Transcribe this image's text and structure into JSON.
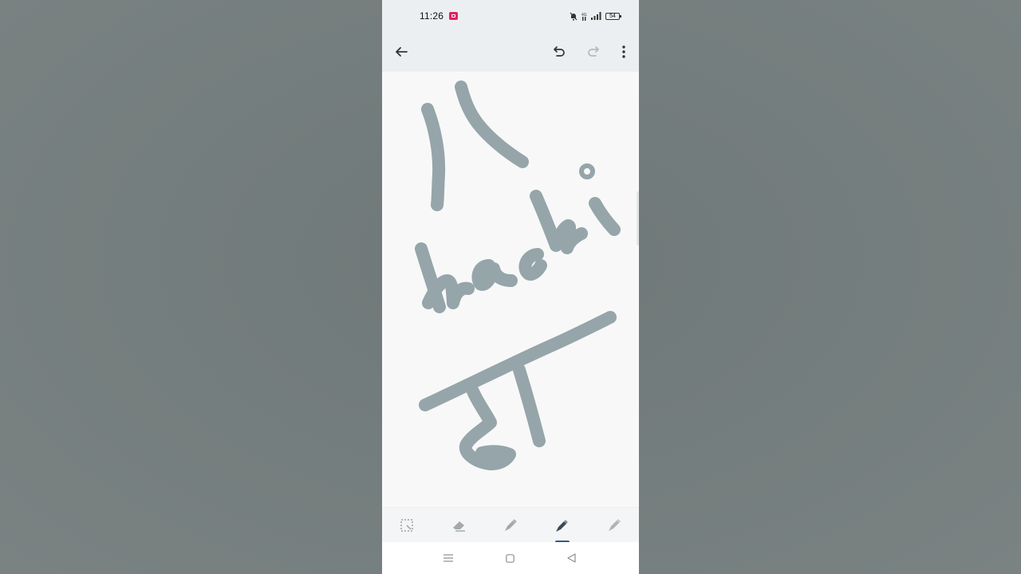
{
  "status_bar": {
    "time": "11:26",
    "battery_level": "54",
    "icons": [
      "screen-record-icon",
      "mute-bell-icon",
      "volte-icon",
      "signal-icon",
      "battery-icon"
    ]
  },
  "toolbar": {
    "back": "back-arrow-icon",
    "undo": "undo-icon",
    "redo": "redo-icon",
    "more": "more-options-icon"
  },
  "drawing": {
    "ink_color": "#95a5aa",
    "strokes_icon": "handwritten-ink"
  },
  "tools": [
    {
      "name": "lasso-select-tool",
      "icon": "lasso-select-icon",
      "active": false
    },
    {
      "name": "eraser-tool",
      "icon": "eraser-icon",
      "active": false
    },
    {
      "name": "pen-tool",
      "icon": "pen-icon",
      "active": false
    },
    {
      "name": "marker-tool",
      "icon": "marker-icon",
      "active": true
    },
    {
      "name": "highlighter-tool",
      "icon": "highlighter-icon",
      "active": false
    }
  ],
  "nav_bar": {
    "recents": "recents-icon",
    "home": "home-icon",
    "back": "back-triangle-icon"
  },
  "colors": {
    "accent": "#2b5d86",
    "toolbar_bg": "#eceff1",
    "canvas_bg": "#f8f8f8",
    "backdrop": "#747d7d"
  }
}
